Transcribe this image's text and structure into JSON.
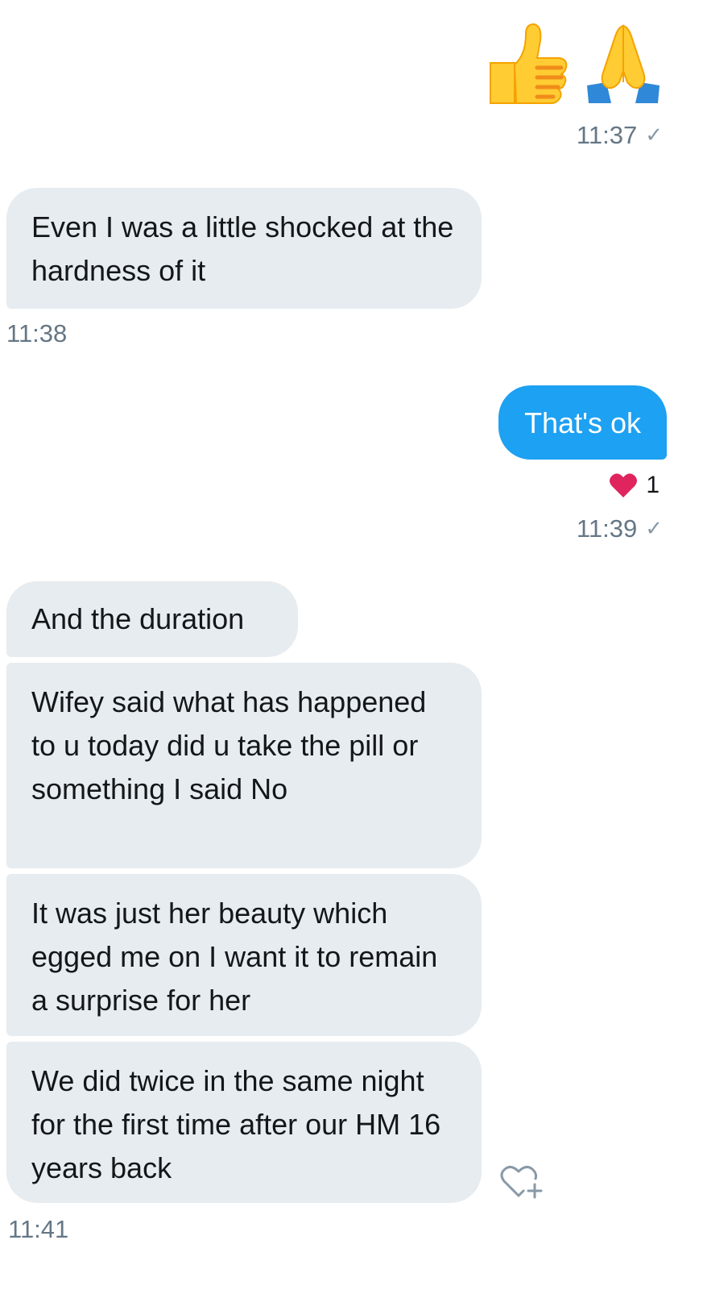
{
  "conversation": {
    "emoji_message": {
      "emojis": [
        "thumbs-up",
        "folded-hands"
      ],
      "time": "11:37",
      "status_icon": "check-icon"
    },
    "msg_1": {
      "text": "Even I was a little shocked at the hardness of it",
      "time": "11:38"
    },
    "msg_2": {
      "text": "That's ok",
      "reaction_icon": "heart-icon",
      "reaction_count": "1",
      "time": "11:39",
      "status_icon": "check-icon"
    },
    "msg_3": {
      "text": "And the duration"
    },
    "msg_4": {
      "text": "Wifey said what has happened to u today did u take the pill or something I said No"
    },
    "msg_5": {
      "text": "It was just her beauty which egged me on I want it to remain a surprise for her"
    },
    "msg_6": {
      "text": "We did twice in the same night for the first time after our HM 16 years back",
      "time": "11:41",
      "react_icon": "heart-plus-icon"
    }
  },
  "colors": {
    "outgoing_bubble": "#1da1f2",
    "incoming_bubble": "#e6ecf0",
    "timestamp": "#657786",
    "heart": "#e0245e"
  }
}
